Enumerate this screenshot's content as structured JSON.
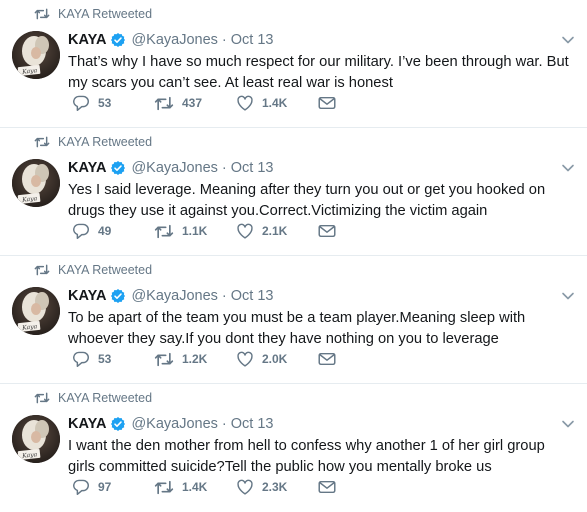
{
  "colors": {
    "text": "#14171a",
    "secondary": "#657786",
    "verified": "#1da1f2",
    "divider": "#e6ecf0"
  },
  "icons": {
    "retweet": "retweet-icon",
    "reply": "reply-icon",
    "like": "heart-icon",
    "dm": "envelope-icon",
    "verified": "verified-badge-icon",
    "menu": "chevron-down-icon"
  },
  "tweets": [
    {
      "retweeted_by": "KAYA Retweeted",
      "name": "KAYA",
      "handle": "@KayaJones",
      "date": "Oct 13",
      "text": "That’s why I have so much respect for our military. I’ve been through war. But my scars you can’t see. At least real war is honest",
      "replies": "53",
      "retweets": "437",
      "likes": "1.4K"
    },
    {
      "retweeted_by": "KAYA Retweeted",
      "name": "KAYA",
      "handle": "@KayaJones",
      "date": "Oct 13",
      "text": "Yes I said leverage. Meaning after they turn you out or get you hooked on drugs they use it against you.Correct.Victimizing the victim again",
      "replies": "49",
      "retweets": "1.1K",
      "likes": "2.1K"
    },
    {
      "retweeted_by": "KAYA Retweeted",
      "name": "KAYA",
      "handle": "@KayaJones",
      "date": "Oct 13",
      "text": "To be apart of the team you must be a team player.Meaning sleep with whoever they say.If you dont they have nothing on you to leverage",
      "replies": "53",
      "retweets": "1.2K",
      "likes": "2.0K"
    },
    {
      "retweeted_by": "KAYA Retweeted",
      "name": "KAYA",
      "handle": "@KayaJones",
      "date": "Oct 13",
      "text": "I want the den mother from hell to confess why another 1 of her girl group girls committed suicide?Tell the public how you mentally broke us",
      "replies": "97",
      "retweets": "1.4K",
      "likes": "2.3K"
    }
  ]
}
